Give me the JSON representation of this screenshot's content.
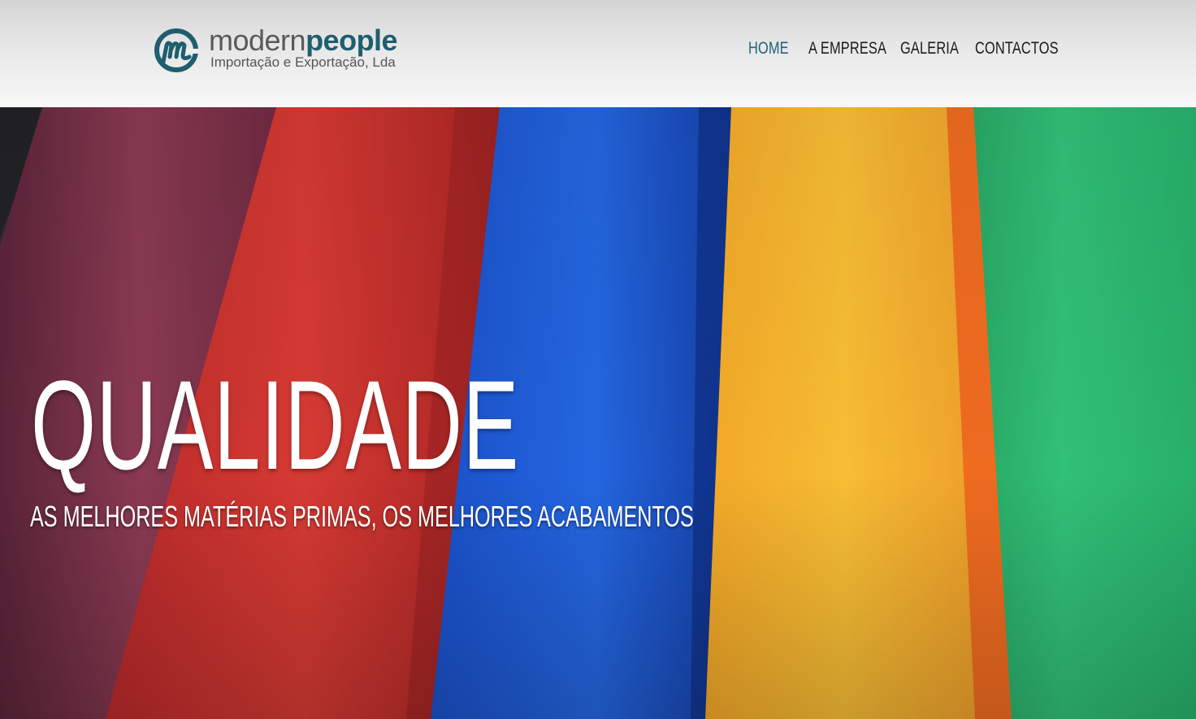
{
  "brand": {
    "name_light": "modern",
    "name_bold": "people",
    "tagline": "Importação e Exportação, Lda",
    "accent_color": "#1e5e6e"
  },
  "nav": {
    "items": [
      {
        "label": "HOME",
        "active": true
      },
      {
        "label": "A EMPRESA",
        "active": false
      },
      {
        "label": "GALERIA",
        "active": false
      },
      {
        "label": "CONTACTOS",
        "active": false
      }
    ]
  },
  "hero": {
    "title": "QUALIDADE",
    "subtitle": "AS MELHORES MATÉRIAS PRIMAS, OS MELHORES ACABAMENTOS",
    "image": "colored-fabric-rolls",
    "fabric_colors": [
      "#8a3a52",
      "#d63a33",
      "#1f5fd6",
      "#f5b830",
      "#ee6b20",
      "#2ebd73"
    ]
  }
}
